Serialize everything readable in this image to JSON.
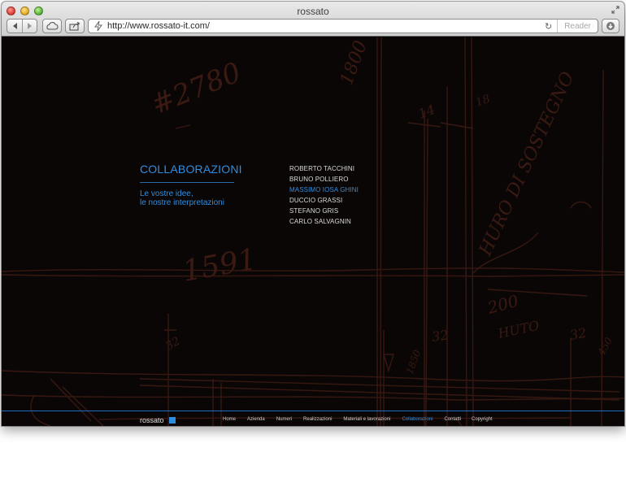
{
  "browser": {
    "title": "rossato",
    "url": "http://www.rossato-it.com/",
    "reader_label": "Reader"
  },
  "page": {
    "section_title": "COLLABORAZIONI",
    "tagline_line1": "Le vostre idee,",
    "tagline_line2": "le nostre interpretazioni",
    "collaborators": [
      "ROBERTO TACCHINI",
      "BRUNO POLLIERO",
      "MASSIMO IOSA GHINI",
      "DUCCIO GRASSI",
      "STEFANO GRIS",
      "CARLO SALVAGNIN"
    ],
    "active_collaborator_index": 2
  },
  "footer": {
    "brand": "rossato",
    "nav": [
      "Home",
      "Azienda",
      "Numeri",
      "Realizzazioni",
      "Materiali e lavorazioni",
      "Collaborazioni",
      "Contatti"
    ],
    "active_nav_index": 5,
    "copyright": "Copyright"
  },
  "colors": {
    "accent": "#2e8ee0",
    "background": "#0b0606",
    "sketch": "#3a1a12"
  },
  "icons": {
    "back": "back-arrow-icon",
    "forward": "forward-arrow-icon",
    "cloud": "icloud-tabs-icon",
    "share": "share-icon",
    "site": "site-favicon-icon",
    "reload": "reload-icon",
    "download": "download-icon",
    "fullscreen": "fullscreen-icon"
  }
}
